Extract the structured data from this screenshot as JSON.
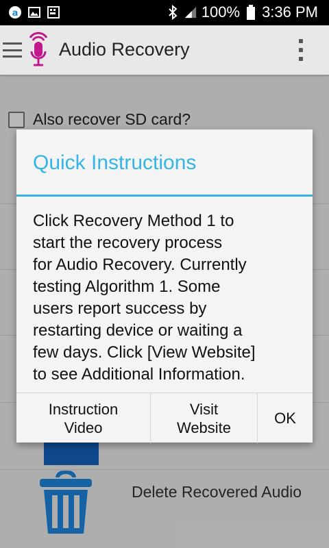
{
  "status_bar": {
    "battery": "100%",
    "time": "3:36 PM",
    "icons": [
      "a-logo-icon",
      "image-icon",
      "keyboard-icon",
      "bluetooth-icon",
      "signal-icon",
      "battery-icon"
    ]
  },
  "app_bar": {
    "title": "Audio Recovery",
    "logo_icon": "microphone-icon",
    "menu_icon": "hamburger-icon",
    "overflow_icon": "overflow-menu-icon",
    "logo_color": "#c2188c"
  },
  "content": {
    "sd_checkbox_label": "Also recover SD card?",
    "sd_checked": false,
    "delete_label": "Delete Recovered Audio",
    "delete_icon": "trash-icon",
    "icon_color": "#1565c0"
  },
  "dialog": {
    "title": "Quick Instructions",
    "accent": "#33b5e5",
    "body_lines": [
      "Click Recovery Method 1 to",
      "start the recovery process",
      "for Audio Recovery. Currently",
      "testing Algorithm 1. Some",
      "users report success by",
      "restarting device or waiting a",
      "few days. Click [View Website]",
      "to see Additional Information."
    ],
    "buttons": {
      "video_line1": "Instruction",
      "video_line2": "Video",
      "website_line1": "Visit",
      "website_line2": "Website",
      "ok": "OK"
    }
  }
}
